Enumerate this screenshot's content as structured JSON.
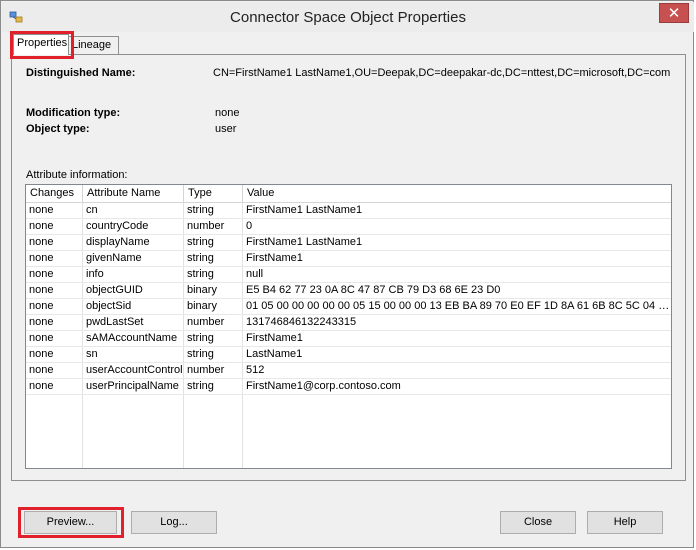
{
  "window": {
    "title": "Connector Space Object Properties",
    "close_glyph": "✕"
  },
  "tabs": [
    {
      "label": "Properties",
      "active": true
    },
    {
      "label": "Lineage",
      "active": false
    }
  ],
  "properties": {
    "dn_label": "Distinguished Name:",
    "dn_value": "CN=FirstName1 LastName1,OU=Deepak,DC=deepakar-dc,DC=nttest,DC=microsoft,DC=com",
    "mod_label": "Modification type:",
    "mod_value": "none",
    "objtype_label": "Object type:",
    "objtype_value": "user",
    "attr_label": "Attribute information:"
  },
  "table": {
    "headers": [
      "Changes",
      "Attribute Name",
      "Type",
      "Value"
    ],
    "rows": [
      [
        "none",
        "cn",
        "string",
        "FirstName1 LastName1"
      ],
      [
        "none",
        "countryCode",
        "number",
        "0"
      ],
      [
        "none",
        "displayName",
        "string",
        "FirstName1 LastName1"
      ],
      [
        "none",
        "givenName",
        "string",
        "FirstName1"
      ],
      [
        "none",
        "info",
        "string",
        "null"
      ],
      [
        "none",
        "objectGUID",
        "binary",
        "E5 B4 62 77 23 0A 8C 47 87 CB 79 D3 68 6E 23 D0"
      ],
      [
        "none",
        "objectSid",
        "binary",
        "01 05 00 00 00 00 00 05 15 00 00 00 13 EB BA 89 70 E0 EF 1D 8A 61 6B 8C 5C 04 00 ..."
      ],
      [
        "none",
        "pwdLastSet",
        "number",
        "131746846132243315"
      ],
      [
        "none",
        "sAMAccountName",
        "string",
        "FirstName1"
      ],
      [
        "none",
        "sn",
        "string",
        "LastName1"
      ],
      [
        "none",
        "userAccountControl",
        "number",
        "512"
      ],
      [
        "none",
        "userPrincipalName",
        "string",
        "FirstName1@corp.contoso.com"
      ]
    ]
  },
  "buttons": {
    "preview": "Preview...",
    "log": "Log...",
    "close": "Close",
    "help": "Help"
  },
  "colors": {
    "highlight": "#e0202a",
    "close_button": "#c75050"
  }
}
